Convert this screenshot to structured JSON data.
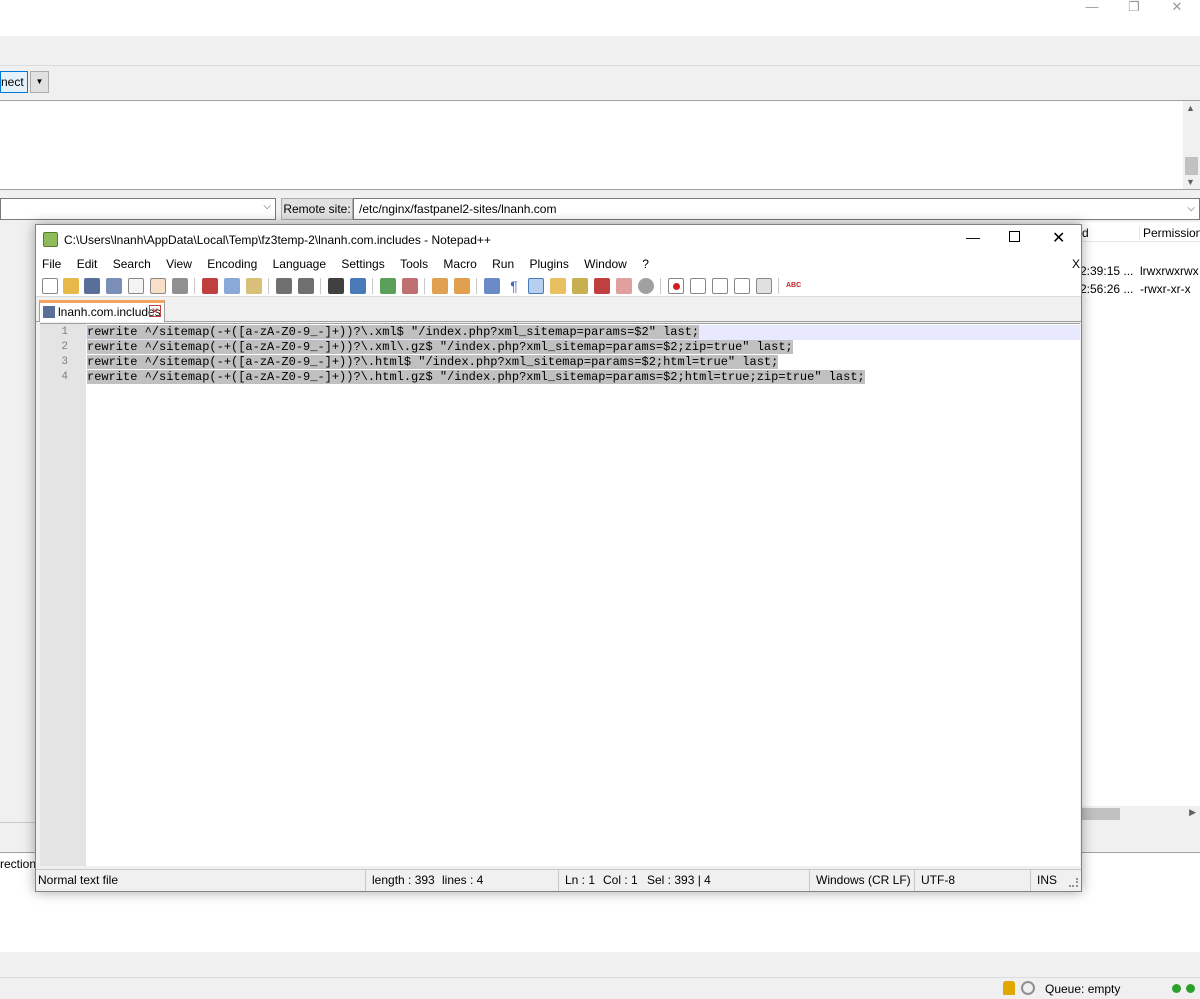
{
  "filezilla": {
    "connect_label": "nect",
    "remote_site_label": "Remote site:",
    "remote_path": "/etc/nginx/fastpanel2-sites/lnanh.com",
    "list_header_modified": "d",
    "list_header_permissions": "Permissions",
    "rows": [
      {
        "time": "2:39:15 ...",
        "perms": "lrwxrwxrwx"
      },
      {
        "time": "2:56:26 ...",
        "perms": "-rwxr-xr-x"
      }
    ],
    "status_log_text": "rection",
    "queue_text": "Queue: empty"
  },
  "notepad": {
    "title": "C:\\Users\\lnanh\\AppData\\Local\\Temp\\fz3temp-2\\lnanh.com.includes - Notepad++",
    "menu": [
      "File",
      "Edit",
      "Search",
      "View",
      "Encoding",
      "Language",
      "Settings",
      "Tools",
      "Macro",
      "Run",
      "Plugins",
      "Window",
      "?"
    ],
    "menu_close": "X",
    "tab_label": "lnanh.com.includes",
    "lines": [
      {
        "num": "1",
        "text": "rewrite ^/sitemap(-+([a-zA-Z0-9_-]+))?\\.xml$ \"/index.php?xml_sitemap=params=$2\" last;"
      },
      {
        "num": "2",
        "text": "rewrite ^/sitemap(-+([a-zA-Z0-9_-]+))?\\.xml\\.gz$ \"/index.php?xml_sitemap=params=$2;zip=true\" last;"
      },
      {
        "num": "3",
        "text": "rewrite ^/sitemap(-+([a-zA-Z0-9_-]+))?\\.html$ \"/index.php?xml_sitemap=params=$2;html=true\" last;"
      },
      {
        "num": "4",
        "text": "rewrite ^/sitemap(-+([a-zA-Z0-9_-]+))?\\.html.gz$ \"/index.php?xml_sitemap=params=$2;html=true;zip=true\" last;"
      }
    ],
    "status": {
      "filetype": "Normal text file",
      "length": "length : 393",
      "lines": "lines : 4",
      "ln": "Ln : 1",
      "col": "Col : 1",
      "sel": "Sel : 393 | 4",
      "eol": "Windows (CR LF)",
      "encoding": "UTF-8",
      "mode": "INS"
    }
  },
  "colors": {
    "selection": "#c0c0c0",
    "current_line": "#e8e8ff",
    "accent": "#0078d7"
  }
}
